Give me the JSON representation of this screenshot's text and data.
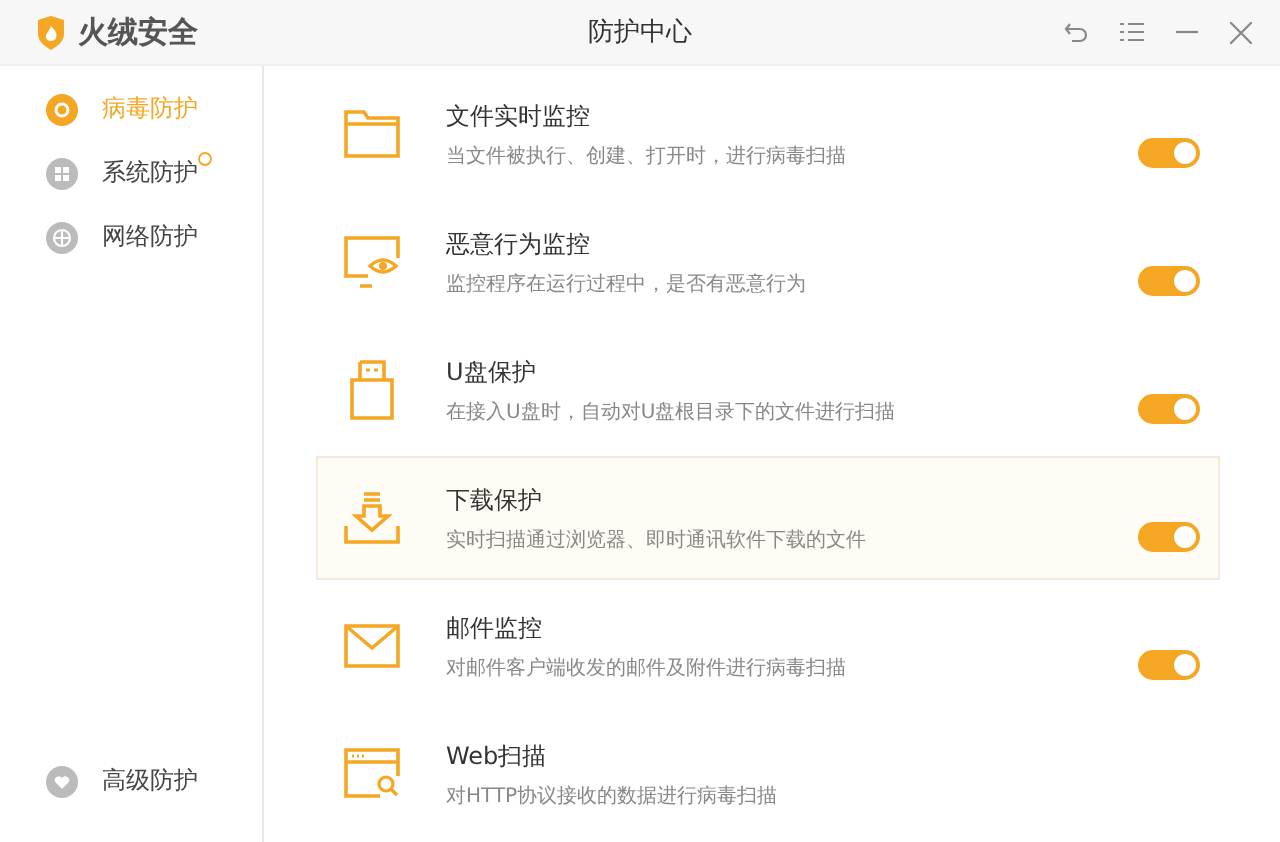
{
  "app": {
    "name": "火绒安全"
  },
  "window": {
    "title": "防护中心"
  },
  "sidebar": {
    "items": [
      {
        "label": "病毒防护",
        "selected": true,
        "kind": "virus"
      },
      {
        "label": "系统防护",
        "selected": false,
        "kind": "system",
        "badge": true
      },
      {
        "label": "网络防护",
        "selected": false,
        "kind": "network"
      }
    ],
    "bottom_item": {
      "label": "高级防护",
      "selected": false
    }
  },
  "features": [
    {
      "kind": "folder",
      "title": "文件实时监控",
      "description": "当文件被执行、创建、打开时，进行病毒扫描",
      "on": true,
      "selected": false
    },
    {
      "kind": "monitor",
      "title": "恶意行为监控",
      "description": "监控程序在运行过程中，是否有恶意行为",
      "on": true,
      "selected": false
    },
    {
      "kind": "usb",
      "title": "U盘保护",
      "description": "在接入U盘时，自动对U盘根目录下的文件进行扫描",
      "on": true,
      "selected": false
    },
    {
      "kind": "download",
      "title": "下载保护",
      "description": "实时扫描通过浏览器、即时通讯软件下载的文件",
      "on": true,
      "selected": true
    },
    {
      "kind": "mail",
      "title": "邮件监控",
      "description": "对邮件客户端收发的邮件及附件进行病毒扫描",
      "on": true,
      "selected": false
    },
    {
      "kind": "web",
      "title": "Web扫描",
      "description": "对HTTP协议接收的数据进行病毒扫描",
      "selected": false
    }
  ]
}
